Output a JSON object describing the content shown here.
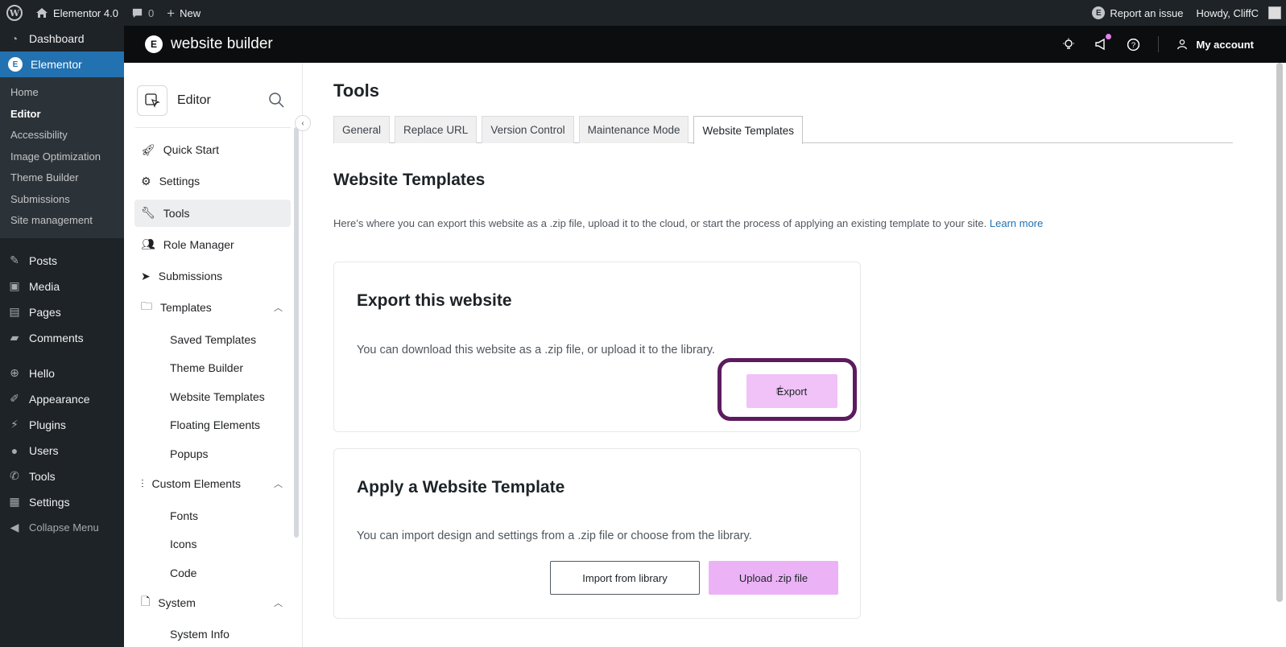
{
  "adminbar": {
    "site_name": "Elementor 4.0",
    "comments_count": "0",
    "new_label": "New",
    "report_label": "Report an issue",
    "howdy": "Howdy, CliffC"
  },
  "wp_menu": {
    "dashboard": "Dashboard",
    "elementor": "Elementor",
    "elementor_sub": [
      "Home",
      "Editor",
      "Accessibility",
      "Image Optimization",
      "Theme Builder",
      "Submissions",
      "Site management"
    ],
    "posts": "Posts",
    "media": "Media",
    "pages": "Pages",
    "comments": "Comments",
    "hello": "Hello",
    "appearance": "Appearance",
    "plugins": "Plugins",
    "users": "Users",
    "tools": "Tools",
    "settings": "Settings",
    "collapse": "Collapse Menu"
  },
  "header": {
    "brand": "website builder",
    "account": "My account"
  },
  "eside": {
    "title": "Editor",
    "nav": {
      "quick_start": "Quick Start",
      "settings": "Settings",
      "tools": "Tools",
      "role_manager": "Role Manager",
      "submissions": "Submissions",
      "templates": "Templates",
      "templates_sub": [
        "Saved Templates",
        "Theme Builder",
        "Website Templates",
        "Floating Elements",
        "Popups"
      ],
      "custom_elements": "Custom Elements",
      "custom_sub": [
        "Fonts",
        "Icons",
        "Code"
      ],
      "system": "System",
      "system_sub": [
        "System Info"
      ]
    }
  },
  "main": {
    "title": "Tools",
    "tabs": [
      "General",
      "Replace URL",
      "Version Control",
      "Maintenance Mode",
      "Website Templates"
    ],
    "active_tab": "Website Templates",
    "section_title": "Website Templates",
    "intro": "Here’s where you can export this website as a .zip file, upload it to the cloud, or start the process of applying an existing template to your site.",
    "learn_more": "Learn more",
    "export_card": {
      "title": "Export this website",
      "text": "You can download this website as a .zip file, or upload it to the library.",
      "button": "Export"
    },
    "apply_card": {
      "title": "Apply a Website Template",
      "text": "You can import design and settings from a .zip file or choose from the library.",
      "import_button": "Import from library",
      "upload_button": "Upload .zip file"
    }
  },
  "colors": {
    "accent_pink": "#f0c2f7",
    "highlight": "#5c1b5f",
    "wp_blue": "#2271b1"
  }
}
